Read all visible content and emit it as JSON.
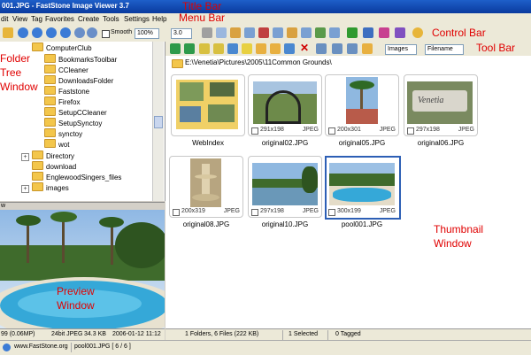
{
  "window": {
    "title": "001.JPG - FastStone Image Viewer 3.7"
  },
  "annotations": {
    "title_bar": "Title Bar",
    "menu_bar": "Menu Bar",
    "control_bar": "Control Bar",
    "tool_bar": "Tool Bar",
    "folder_tree": [
      "Folder",
      "Tree",
      "Window"
    ],
    "preview": [
      "Preview",
      "Window"
    ],
    "thumbnail": [
      "Thumbnail",
      "Window"
    ]
  },
  "menu": [
    "dit",
    "View",
    "Tag",
    "Favorites",
    "Create",
    "Tools",
    "Settings",
    "Help"
  ],
  "controls": {
    "smooth_label": "Smooth",
    "zoom": "100%",
    "ratio": "3.0",
    "filter": "Images",
    "sort": "Filename"
  },
  "tree": {
    "items": [
      {
        "label": "ComputerClub"
      },
      {
        "label": "BookmarksToolbar"
      },
      {
        "label": "CCleaner"
      },
      {
        "label": "DownloadsFolder"
      },
      {
        "label": "Faststone"
      },
      {
        "label": "Firefox"
      },
      {
        "label": "SetupCCleaner"
      },
      {
        "label": "SetupSynctoy"
      },
      {
        "label": "synctoy"
      },
      {
        "label": "wot"
      },
      {
        "label": "Directory"
      },
      {
        "label": "download"
      },
      {
        "label": "EnglewoodSingers_files"
      },
      {
        "label": "images"
      }
    ]
  },
  "preview": {
    "header": "w"
  },
  "path": "E:\\Venetia\\Pictures\\2005\\11Common Grounds\\",
  "thumbnails": [
    {
      "name": "WebIndex",
      "dim": "",
      "fmt": ""
    },
    {
      "name": "original02.JPG",
      "dim": "291x198",
      "fmt": "JPEG"
    },
    {
      "name": "original05.JPG",
      "dim": "200x301",
      "fmt": "JPEG"
    },
    {
      "name": "original06.JPG",
      "dim": "297x198",
      "fmt": "JPEG"
    },
    {
      "name": "original08.JPG",
      "dim": "200x319",
      "fmt": "JPEG"
    },
    {
      "name": "original10.JPG",
      "dim": "297x198",
      "fmt": "JPEG"
    },
    {
      "name": "pool001.JPG",
      "dim": "300x199",
      "fmt": "JPEG"
    }
  ],
  "status": {
    "preview_info": [
      "99 (0.06MP)",
      "24bit JPEG",
      "34.3 KB",
      "2006-01-12 11:12"
    ],
    "folder_info": "1 Folders, 6 Files (222 KB)",
    "selected": "1 Selected",
    "tagged": "0 Tagged",
    "website": "www.FastStone.org",
    "current": "pool001.JPG [ 6 / 6 ]"
  },
  "colors": {
    "annotation": "#e00000",
    "selection": "#2d5fb5"
  }
}
